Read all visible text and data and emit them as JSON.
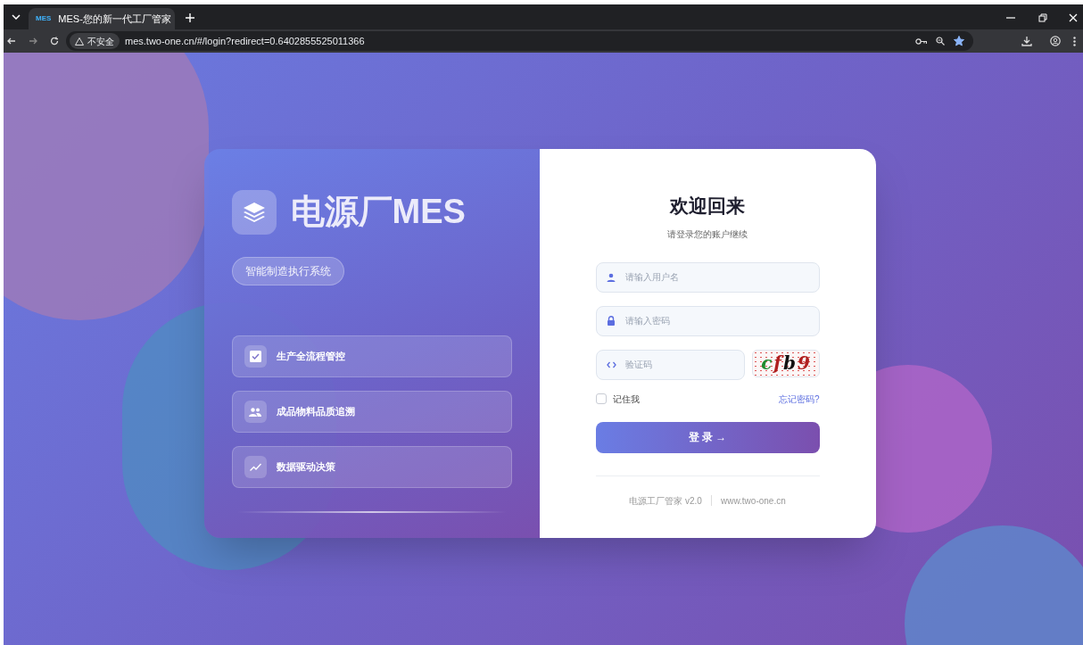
{
  "browser": {
    "tab_title": "MES-您的新一代工厂管家",
    "tab_favicon": "MES",
    "address_security": "不安全",
    "url": "mes.two-one.cn/#/login?redirect=0.6402855525011366",
    "bookmarked": true
  },
  "brand": {
    "title": "电源厂MES",
    "subtitle": "智能制造执行系统"
  },
  "features": [
    {
      "kind": "check",
      "label": "生产全流程管控"
    },
    {
      "kind": "people",
      "label": "成品物料品质追溯"
    },
    {
      "kind": "trend",
      "label": "数据驱动决策"
    }
  ],
  "login": {
    "heading": "欢迎回来",
    "subheading": "请登录您的账户继续",
    "username": {
      "placeholder": "请输入用户名"
    },
    "password": {
      "placeholder": "请输入密码"
    },
    "captcha": {
      "placeholder": "验证码",
      "characters": [
        {
          "char": "c",
          "color": "#1f8a2e"
        },
        {
          "char": "f",
          "color": "#b02020"
        },
        {
          "char": "b",
          "color": "#111111"
        },
        {
          "char": "9",
          "color": "#b02020"
        }
      ]
    },
    "remember": {
      "label": "记住我",
      "checked": false
    },
    "forgot_link": "忘记密码?",
    "submit": "登 录 →",
    "footer": [
      "电源工厂管家 v2.0",
      "www.two-one.cn"
    ]
  }
}
